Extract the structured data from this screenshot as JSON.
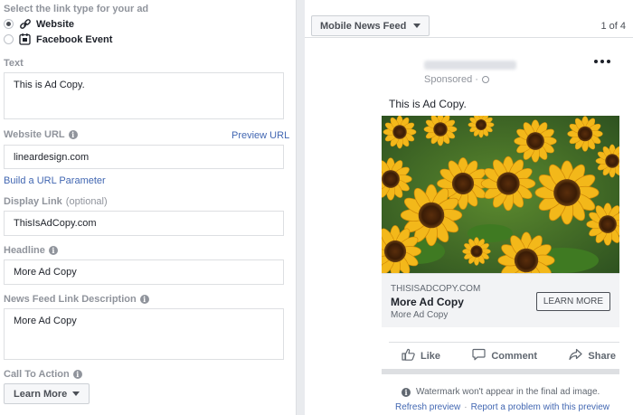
{
  "link_type": {
    "label": "Select the link type for your ad",
    "options": [
      {
        "label": "Website",
        "selected": true
      },
      {
        "label": "Facebook Event",
        "selected": false
      }
    ]
  },
  "fields": {
    "text": {
      "label": "Text",
      "value": "This is Ad Copy."
    },
    "website_url": {
      "label": "Website URL",
      "value": "lineardesign.com",
      "preview_link": "Preview URL",
      "build_link": "Build a URL Parameter"
    },
    "display_link": {
      "label": "Display Link",
      "optional": "(optional)",
      "value": "ThisIsAdCopy.com"
    },
    "headline": {
      "label": "Headline",
      "value": "More Ad Copy"
    },
    "news_feed_desc": {
      "label": "News Feed Link Description",
      "value": "More Ad Copy"
    },
    "cta": {
      "label": "Call To Action",
      "value": "Learn More"
    }
  },
  "preview": {
    "placement": "Mobile News Feed",
    "pager": "1 of 4",
    "sponsored": "Sponsored · ",
    "ad_text": "This is Ad Copy.",
    "link_domain": "THISISADCOPY.COM",
    "link_headline": "More Ad Copy",
    "link_desc": "More Ad Copy",
    "cta_button": "LEARN MORE",
    "actions": {
      "like": "Like",
      "comment": "Comment",
      "share": "Share"
    },
    "watermark_note": "Watermark won't appear in the final ad image.",
    "refresh": "Refresh preview",
    "separator": "·",
    "report": "Report a problem with this preview"
  },
  "colors": {
    "link": "#4267b2",
    "muted": "#90949c"
  },
  "icons": [
    "link-icon",
    "calendar-icon",
    "info-icon",
    "caret-down-icon",
    "globe-icon",
    "more-dots-icon",
    "like-icon",
    "comment-icon",
    "share-icon"
  ]
}
